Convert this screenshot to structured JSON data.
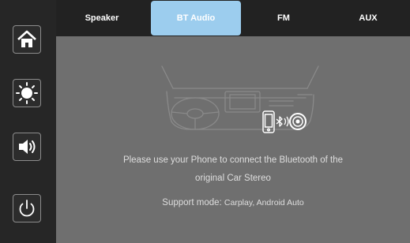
{
  "sidebar": {
    "buttons": [
      {
        "name": "home",
        "icon": "home-icon"
      },
      {
        "name": "brightness",
        "icon": "brightness-icon"
      },
      {
        "name": "volume",
        "icon": "speaker-volume-icon"
      },
      {
        "name": "power",
        "icon": "power-icon"
      }
    ]
  },
  "tabs": [
    {
      "label": "Speaker",
      "active": false
    },
    {
      "label": "BT Audio",
      "active": true
    },
    {
      "label": "FM",
      "active": false
    },
    {
      "label": "AUX",
      "active": false
    }
  ],
  "main": {
    "illustration": "car-dashboard-phone-bluetooth-illustration",
    "message_line1": "Please use your Phone to connect the Bluetooth of the",
    "message_line2": "original Car Stereo",
    "support_label": "Support mode: ",
    "support_value": "Carplay, Android Auto"
  },
  "colors": {
    "sidebar_bg": "#262626",
    "tabbar_bg": "#222222",
    "active_tab": "#9ccdee",
    "main_bg": "#6f6f6f",
    "text": "#dedede"
  }
}
